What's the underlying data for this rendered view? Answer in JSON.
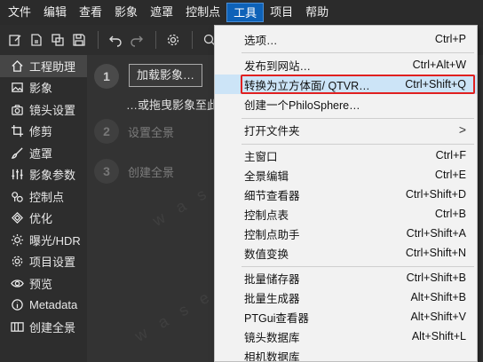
{
  "menubar": {
    "items": [
      "文件",
      "编辑",
      "查看",
      "影象",
      "遮罩",
      "控制点",
      "工具",
      "项目",
      "帮助"
    ]
  },
  "sidebar": {
    "items": [
      {
        "label": "工程助理",
        "icon": "home-icon"
      },
      {
        "label": "影象",
        "icon": "image-icon"
      },
      {
        "label": "镜头设置",
        "icon": "camera-icon"
      },
      {
        "label": "修剪",
        "icon": "crop-icon"
      },
      {
        "label": "遮罩",
        "icon": "brush-icon"
      },
      {
        "label": "影象参数",
        "icon": "sliders-icon"
      },
      {
        "label": "控制点",
        "icon": "control-points-icon"
      },
      {
        "label": "优化",
        "icon": "optimize-icon"
      },
      {
        "label": "曝光/HDR",
        "icon": "sun-icon"
      },
      {
        "label": "项目设置",
        "icon": "project-settings-icon"
      },
      {
        "label": "预览",
        "icon": "eye-icon"
      },
      {
        "label": "Metadata",
        "icon": "info-icon"
      },
      {
        "label": "创建全景",
        "icon": "panorama-icon"
      }
    ]
  },
  "main": {
    "step1_number": "1",
    "load_button": "加载影象…",
    "drag_text": "…或拖曳影象至此",
    "step2_number": "2",
    "step2_label": "设置全景",
    "step3_number": "3",
    "step3_label": "创建全景"
  },
  "tools_menu": {
    "items": [
      {
        "label": "选项…",
        "shortcut": "Ctrl+P"
      },
      {
        "label": "发布到网站…",
        "shortcut": "Ctrl+Alt+W"
      },
      {
        "label": "转换为立方体面/ QTVR…",
        "shortcut": "Ctrl+Shift+Q"
      },
      {
        "label": "创建一个PhiloSphere…",
        "shortcut": ""
      },
      {
        "label": "打开文件夹",
        "shortcut": ">"
      },
      {
        "label": "主窗口",
        "shortcut": "Ctrl+F"
      },
      {
        "label": "全景编辑",
        "shortcut": "Ctrl+E"
      },
      {
        "label": "细节查看器",
        "shortcut": "Ctrl+Shift+D"
      },
      {
        "label": "控制点表",
        "shortcut": "Ctrl+B"
      },
      {
        "label": "控制点助手",
        "shortcut": "Ctrl+Shift+A"
      },
      {
        "label": "数值变换",
        "shortcut": "Ctrl+Shift+N"
      },
      {
        "label": "批量储存器",
        "shortcut": "Ctrl+Shift+B"
      },
      {
        "label": "批量生成器",
        "shortcut": "Alt+Shift+B"
      },
      {
        "label": "PTGui查看器",
        "shortcut": "Alt+Shift+V"
      },
      {
        "label": "镜头数据库",
        "shortcut": "Alt+Shift+L"
      },
      {
        "label": "相机数据库",
        "shortcut": ""
      }
    ]
  },
  "colors": {
    "menu_active": "#0e62b8",
    "highlight_bg": "#cce4f7",
    "highlight_border": "#e02020"
  }
}
